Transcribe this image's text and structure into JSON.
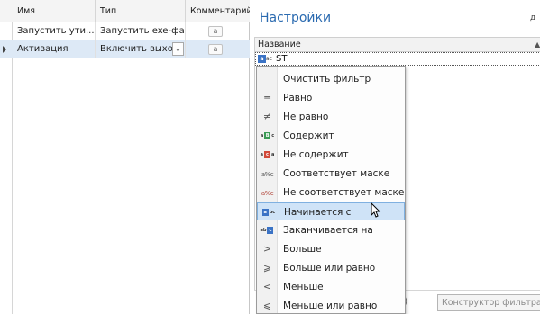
{
  "grid": {
    "columns": [
      "Имя",
      "Тип",
      "Комментарий"
    ],
    "rows": [
      {
        "name": "Запустить ути...",
        "type": "Запустить exe-файл",
        "comment_button": "a",
        "selected": false
      },
      {
        "name": "Активация",
        "type": "Включить выход",
        "comment_button": "a",
        "selected": true,
        "combo_arrow": "⌄"
      }
    ]
  },
  "panel": {
    "title": "Настройки",
    "corner_text": "д",
    "column_header": "Название",
    "sort_indicator": "▲",
    "filter_value": "ST",
    "filter_op_icon": "a",
    "filter_op_icon_suffix": "ac",
    "footer_paren": ")",
    "builder_button": "Конструктор фильтра..."
  },
  "menu": {
    "items": [
      {
        "label": "Очистить фильтр",
        "icon": ""
      },
      {
        "label": "Равно",
        "icon": "equals-icon",
        "glyph": "═"
      },
      {
        "label": "Не равно",
        "icon": "not-equal-icon",
        "glyph": "≠"
      },
      {
        "label": "Содержит",
        "icon": "contains-icon"
      },
      {
        "label": "Не содержит",
        "icon": "not-contains-icon"
      },
      {
        "label": "Соответствует маске",
        "icon": "like-icon",
        "glyph": "a%c"
      },
      {
        "label": "Не соответствует маске",
        "icon": "not-like-icon",
        "glyph": "a%c"
      },
      {
        "label": "Начинается с",
        "icon": "begins-with-icon",
        "selected": true
      },
      {
        "label": "Заканчивается на",
        "icon": "ends-with-icon"
      },
      {
        "label": "Больше",
        "icon": "greater-icon",
        "glyph": ">"
      },
      {
        "label": "Больше или равно",
        "icon": "greater-or-equal-icon",
        "glyph": "⩾"
      },
      {
        "label": "Меньше",
        "icon": "less-icon",
        "glyph": "<"
      },
      {
        "label": "Меньше или равно",
        "icon": "less-or-equal-icon",
        "glyph": "⩽"
      }
    ]
  },
  "colors": {
    "accent": "#2a6ab0",
    "selection": "#cfe3f7",
    "row_selection": "#dde9f6"
  }
}
